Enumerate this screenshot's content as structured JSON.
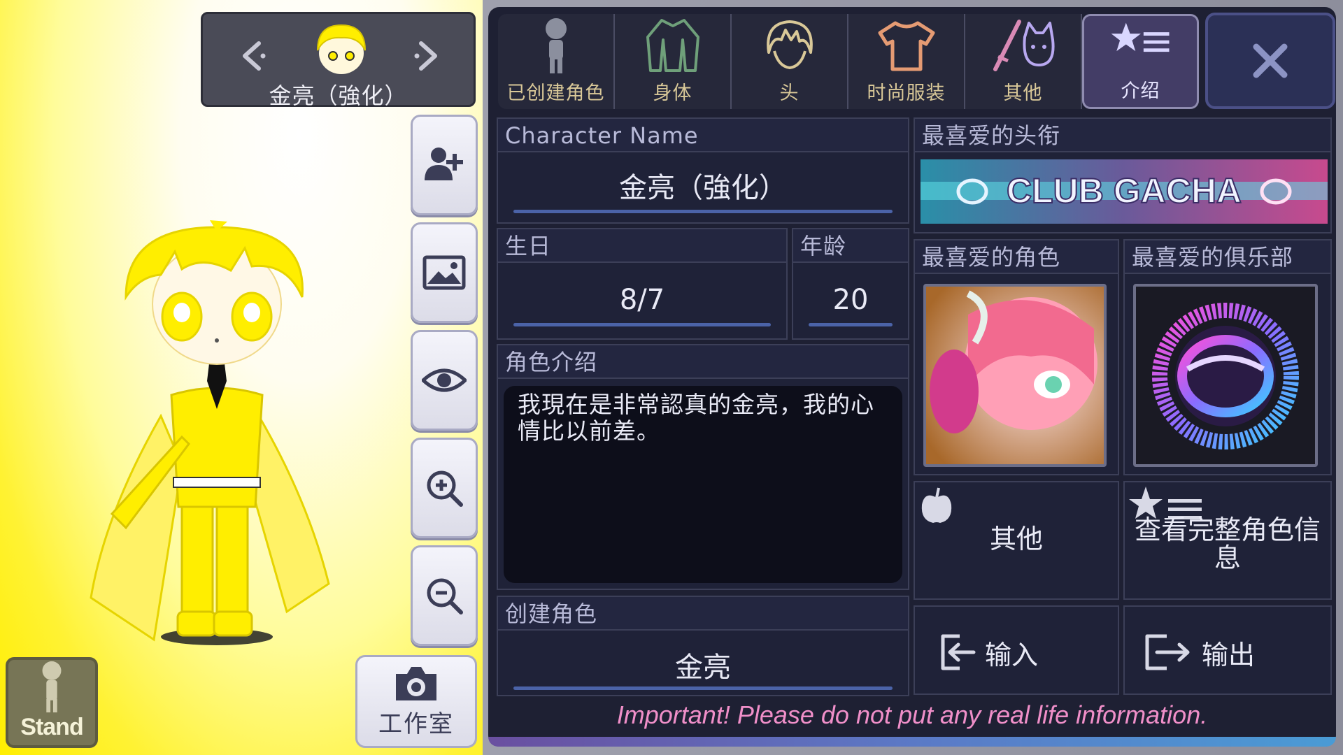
{
  "selector": {
    "name": "金亮（強化）",
    "prev_icon": "chevron-left-icon",
    "next_icon": "chevron-right-icon"
  },
  "left_tools": {
    "buttons": [
      "add-character-icon",
      "background-image-icon",
      "eye-icon",
      "zoom-in-icon",
      "zoom-out-icon"
    ],
    "stand_label": "Stand",
    "studio_label": "工作室"
  },
  "tabs": [
    {
      "label": "已创建角色",
      "icon": "character-silhouette-icon"
    },
    {
      "label": "身体",
      "icon": "jacket-icon"
    },
    {
      "label": "头",
      "icon": "hair-icon"
    },
    {
      "label": "时尚服装",
      "icon": "tshirt-icon"
    },
    {
      "label": "其他",
      "icon": "sword-cat-icon"
    },
    {
      "label": "介绍",
      "icon": "star-list-icon",
      "active": true
    }
  ],
  "close_icon": "close-icon",
  "profile": {
    "name_header": "Character Name",
    "name_value": "金亮（強化）",
    "birthday_header": "生日",
    "birthday_value": "8/7",
    "age_header": "年龄",
    "age_value": "20",
    "intro_header": "角色介绍",
    "intro_text": "我現在是非常認真的金亮，我的心情比以前差。",
    "creator_header": "创建角色",
    "creator_value": "金亮"
  },
  "favorites": {
    "title_header": "最喜爱的头衔",
    "title_banner": "CLUB GACHA",
    "character_header": "最喜爱的角色",
    "club_header": "最喜爱的俱乐部"
  },
  "actions": {
    "other_label": "其他",
    "full_info_label": "查看完整角色信息",
    "import_label": "输入",
    "export_label": "输出"
  },
  "warning": "Important! Please do not put any real life information.",
  "colors": {
    "accent_tab": "#433d66",
    "tab_text": "#d9c898",
    "warning_pink": "#f08fc9",
    "underline_blue": "#4b63a8"
  }
}
